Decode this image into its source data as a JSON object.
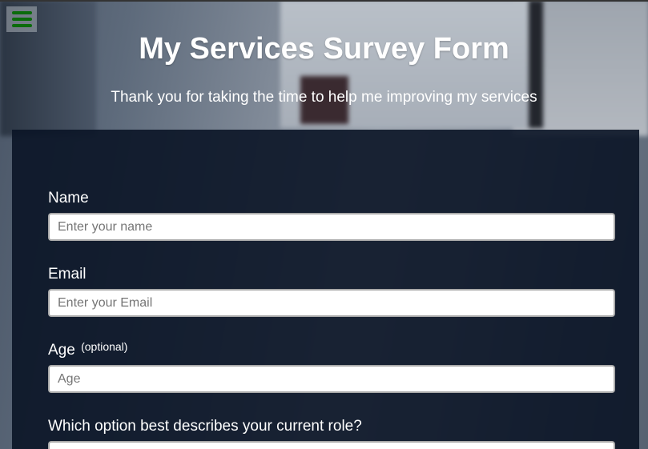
{
  "header": {
    "title": "My Services Survey Form",
    "description": "Thank you for taking the time to help me improving my services"
  },
  "menu": {
    "icon": "hamburger-menu-icon",
    "color": "#0b6b0b"
  },
  "form": {
    "name": {
      "label": "Name",
      "placeholder": "Enter your name",
      "value": ""
    },
    "email": {
      "label": "Email",
      "placeholder": "Enter your Email",
      "value": ""
    },
    "age": {
      "label": "Age",
      "optional": "(optional)",
      "placeholder": "Age",
      "value": ""
    },
    "role": {
      "label": "Which option best describes your current role?"
    }
  }
}
